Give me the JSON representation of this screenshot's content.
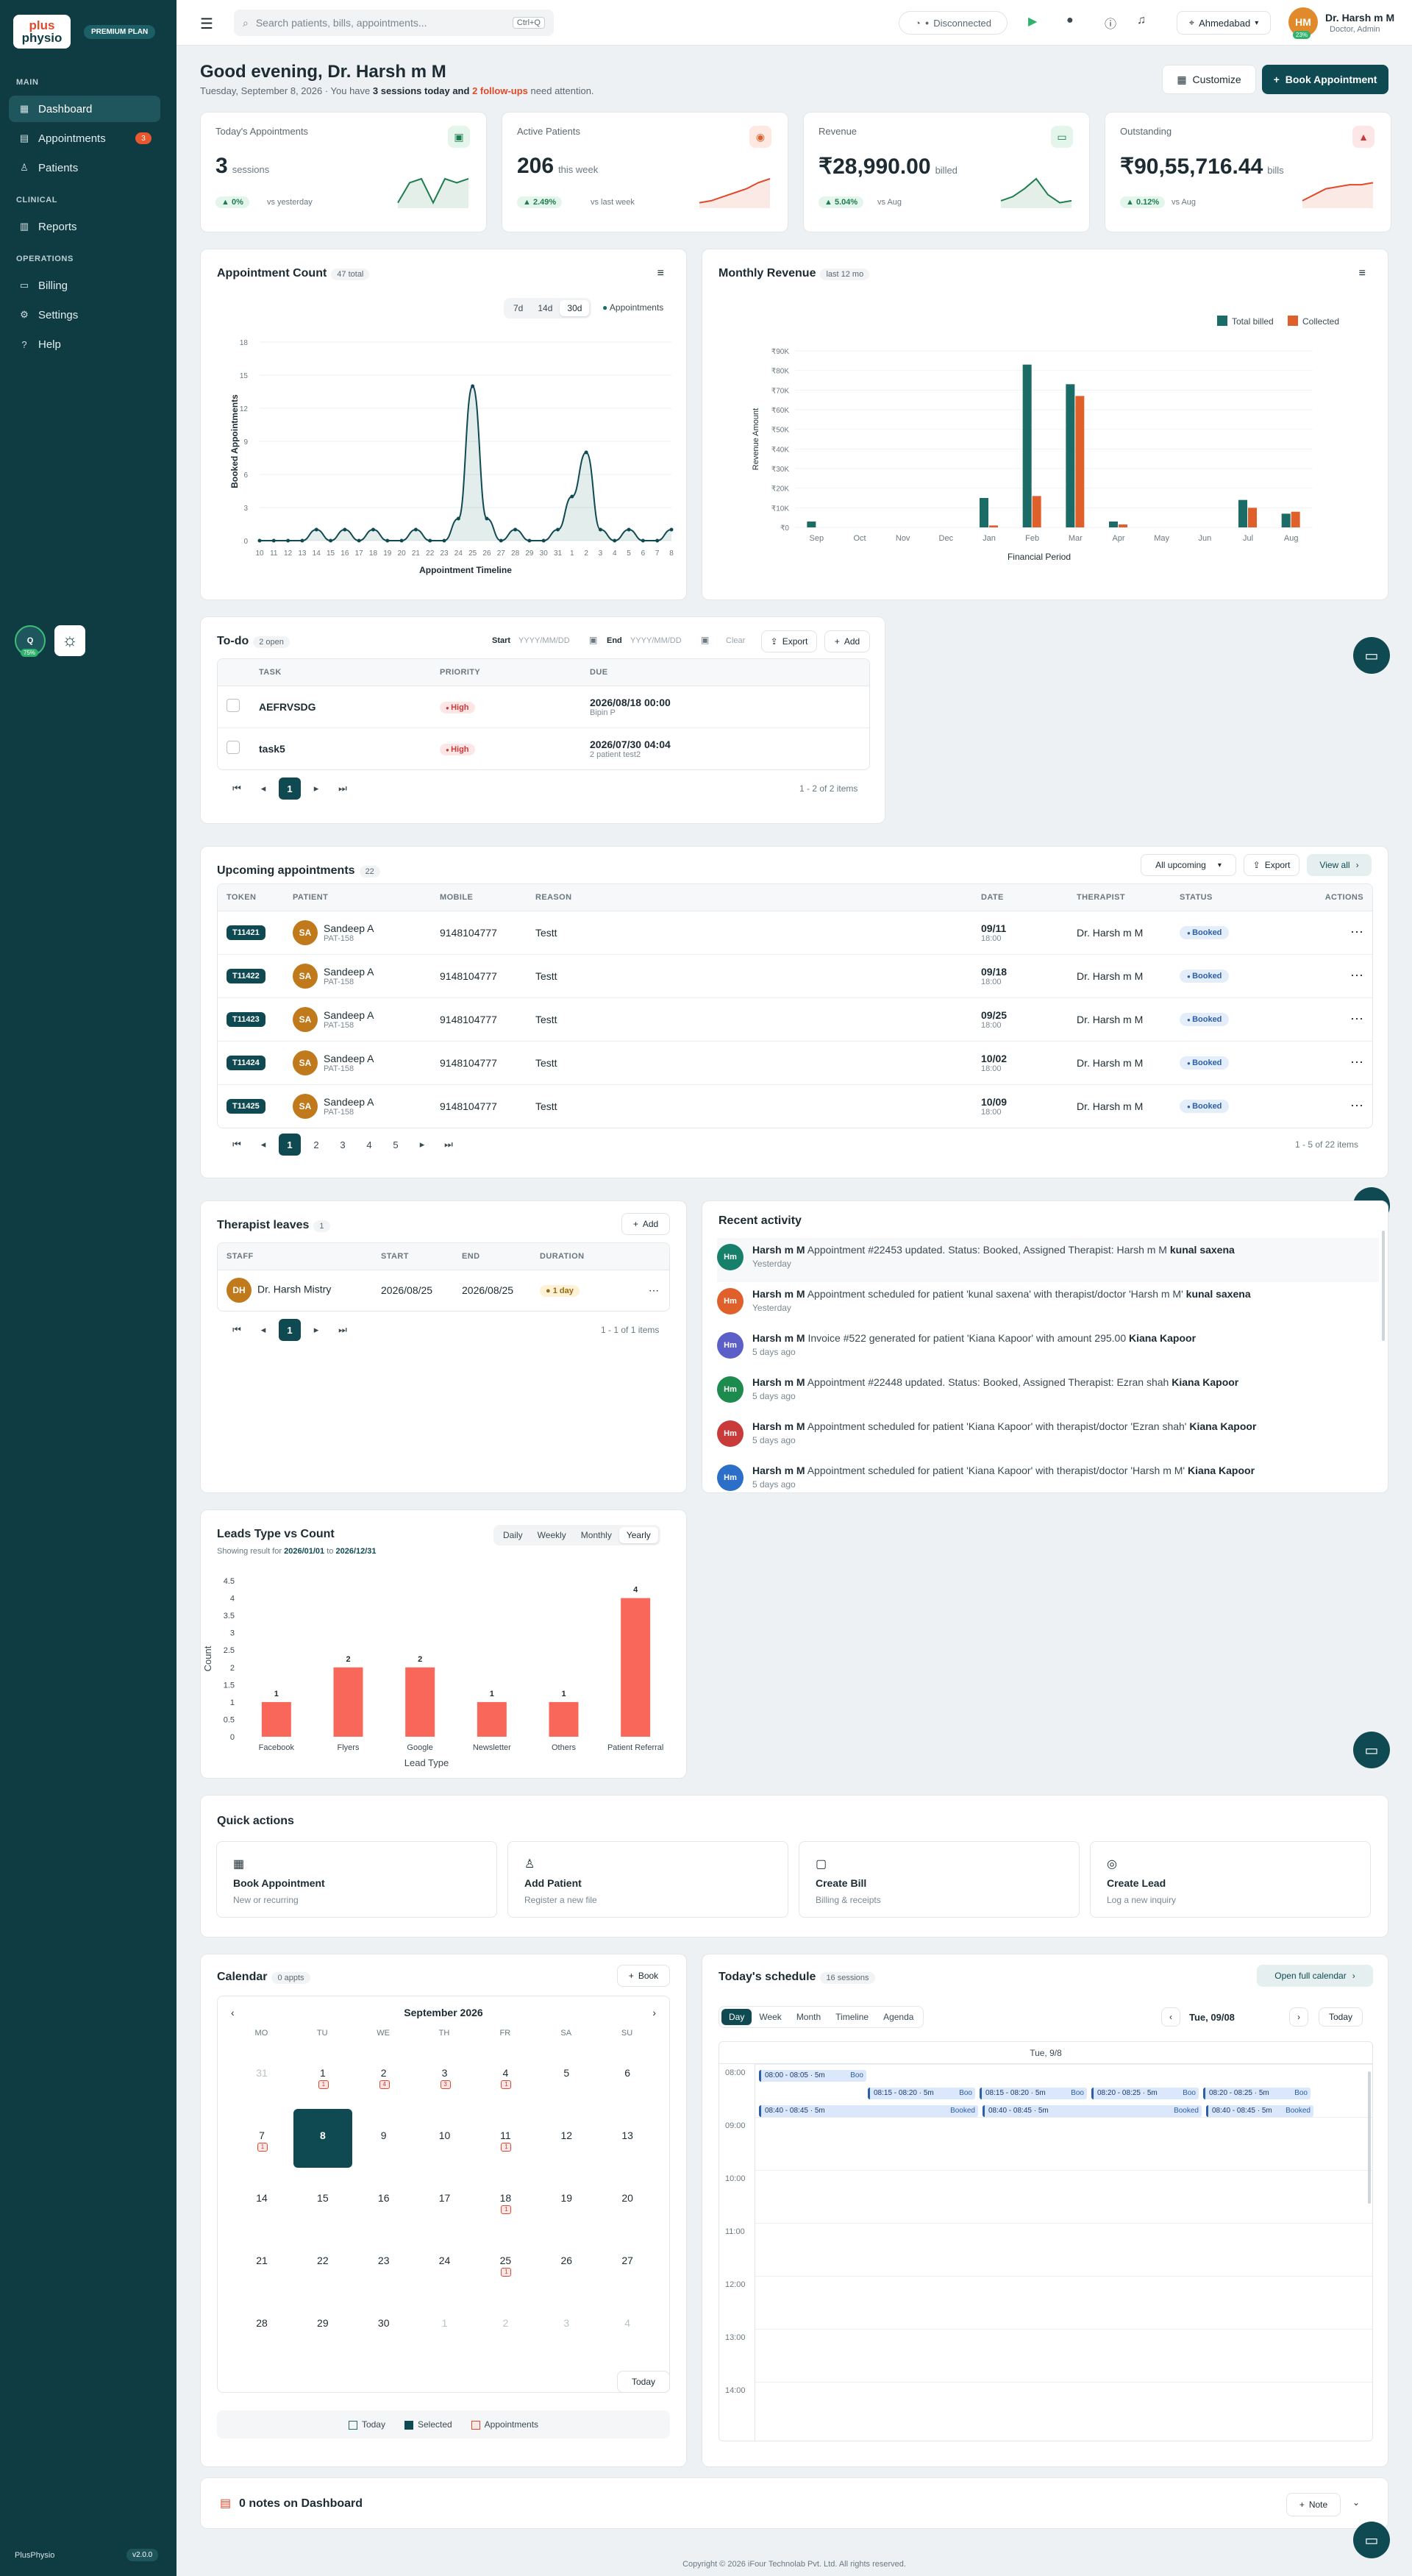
{
  "brand": {
    "logo_top": "plus",
    "logo_bottom": "physio",
    "plan": "PREMIUM PLAN",
    "footer": "PlusPhysio",
    "version": "v2.0.0",
    "widget": "Q",
    "widget_pct": "75%"
  },
  "sidebar": {
    "sections": [
      {
        "label": "MAIN"
      },
      {
        "label": "CLINICAL"
      },
      {
        "label": "OPERATIONS"
      }
    ],
    "items": [
      {
        "label": "Dashboard",
        "icon": "▦"
      },
      {
        "label": "Appointments",
        "icon": "▤",
        "badge": "3"
      },
      {
        "label": "Patients",
        "icon": "♙"
      },
      {
        "label": "Reports",
        "icon": "▥"
      },
      {
        "label": "Billing",
        "icon": "▭"
      },
      {
        "label": "Settings",
        "icon": "⚙"
      },
      {
        "label": "Help",
        "icon": "?"
      }
    ]
  },
  "topbar": {
    "search_placeholder": "Search patients, bills, appointments...",
    "shortcut": "Ctrl+Q",
    "connection": "Disconnected",
    "location": "Ahmedabad",
    "user_initials": "HM",
    "user_pct": "23%",
    "user_name": "Dr. Harsh m M",
    "user_role": "Doctor, Admin"
  },
  "greeting": {
    "title": "Good evening, Dr. Harsh m M",
    "date": "Tuesday, September 8, 2026 · You have",
    "sessions": "3 sessions today",
    "and": "and",
    "followups": "2 follow-ups",
    "tail": "need attention.",
    "customize": "Customize",
    "book": "Book Appointment"
  },
  "kpis": [
    {
      "label": "Today's Appointments",
      "value": "3",
      "unit": "sessions",
      "change": "0%",
      "vs": "vs yesterday",
      "color": "#1d7d4e",
      "spark": [
        2,
        12,
        14,
        2,
        14,
        12,
        14
      ]
    },
    {
      "label": "Active Patients",
      "value": "206",
      "unit": "this week",
      "change": "2.49%",
      "vs": "vs last week",
      "color": "#e2492a",
      "spark": [
        2,
        3,
        5,
        7,
        9,
        12,
        14
      ]
    },
    {
      "label": "Revenue",
      "value": "₹28,990.00",
      "unit": "billed",
      "change": "5.04%",
      "vs": "vs Aug",
      "color": "#1d7d4e",
      "spark": [
        3,
        5,
        9,
        14,
        6,
        2,
        3
      ]
    },
    {
      "label": "Outstanding",
      "value": "₹90,55,716.44",
      "unit": "bills",
      "change": "0.12%",
      "vs": "vs Aug",
      "color": "#e2492a",
      "spark": [
        3,
        6,
        9,
        10,
        11,
        11,
        12
      ]
    }
  ],
  "appt_chart": {
    "title": "Appointment Count",
    "total": "47 total",
    "ranges": [
      "7d",
      "14d",
      "30d"
    ],
    "active_range": "30d",
    "legend": "Appointments",
    "chart_data": {
      "type": "line",
      "xlabel": "Appointment Timeline",
      "ylabel": "Booked Appointments",
      "ylim": [
        0,
        18
      ],
      "yticks": [
        0,
        3,
        6,
        9,
        12,
        15,
        18
      ],
      "categories": [
        "10",
        "11",
        "12",
        "13",
        "14",
        "15",
        "16",
        "17",
        "18",
        "19",
        "20",
        "21",
        "22",
        "23",
        "24",
        "25",
        "26",
        "27",
        "28",
        "29",
        "30",
        "31",
        "1",
        "2",
        "3",
        "4",
        "5",
        "6",
        "7",
        "8"
      ],
      "values": [
        0,
        0,
        0,
        0,
        1,
        0,
        1,
        0,
        1,
        0,
        0,
        1,
        0,
        0,
        2,
        14,
        2,
        0,
        1,
        0,
        0,
        1,
        4,
        8,
        1,
        0,
        1,
        0,
        0,
        1
      ]
    }
  },
  "rev_chart": {
    "title": "Monthly Revenue",
    "tag": "last 12 mo",
    "chart_data": {
      "type": "bar",
      "xlabel": "Financial Period",
      "ylabel": "Revenue Amount",
      "ylim": [
        0,
        90000
      ],
      "yticks": [
        "₹0",
        "₹10K",
        "₹20K",
        "₹30K",
        "₹40K",
        "₹50K",
        "₹60K",
        "₹70K",
        "₹80K",
        "₹90K"
      ],
      "categories": [
        "Sep",
        "Oct",
        "Nov",
        "Dec",
        "Jan",
        "Feb",
        "Mar",
        "Apr",
        "May",
        "Jun",
        "Jul",
        "Aug"
      ],
      "series": [
        {
          "name": "Total billed",
          "color": "#1b6b66",
          "values": [
            3000,
            0,
            0,
            0,
            15000,
            83000,
            73000,
            3000,
            0,
            0,
            14000,
            7000
          ]
        },
        {
          "name": "Collected",
          "color": "#e0602c",
          "values": [
            0,
            0,
            0,
            0,
            1000,
            16000,
            67000,
            1500,
            0,
            0,
            10000,
            8000
          ]
        }
      ]
    }
  },
  "todo": {
    "title": "To-do",
    "count": "2 open",
    "start": "Start",
    "end": "End",
    "date_ph": "YYYY/MM/DD",
    "clear": "Clear",
    "export": "Export",
    "add": "Add",
    "headers": [
      "TASK",
      "PRIORITY",
      "DUE"
    ],
    "rows": [
      {
        "task": "AEFRVSDG",
        "priority": "High",
        "due": "2026/08/18 00:00",
        "who": "Bipin P"
      },
      {
        "task": "task5",
        "priority": "High",
        "due": "2026/07/30 04:04",
        "who": "2 patient test2"
      }
    ],
    "page": "1",
    "info": "1 - 2 of 2 items"
  },
  "upcoming": {
    "title": "Upcoming appointments",
    "count": "22",
    "filter": "All upcoming",
    "export": "Export",
    "view_all": "View all",
    "headers": [
      "TOKEN",
      "PATIENT",
      "MOBILE",
      "REASON",
      "DATE",
      "THERAPIST",
      "STATUS",
      "ACTIONS"
    ],
    "rows": [
      {
        "token": "T11421",
        "initials": "SA",
        "name": "Sandeep A",
        "pid": "PAT-158",
        "mobile": "9148104777",
        "reason": "Testt",
        "date": "09/11",
        "time": "18:00",
        "therapist": "Dr. Harsh m M",
        "status": "Booked"
      },
      {
        "token": "T11422",
        "initials": "SA",
        "name": "Sandeep A",
        "pid": "PAT-158",
        "mobile": "9148104777",
        "reason": "Testt",
        "date": "09/18",
        "time": "18:00",
        "therapist": "Dr. Harsh m M",
        "status": "Booked"
      },
      {
        "token": "T11423",
        "initials": "SA",
        "name": "Sandeep A",
        "pid": "PAT-158",
        "mobile": "9148104777",
        "reason": "Testt",
        "date": "09/25",
        "time": "18:00",
        "therapist": "Dr. Harsh m M",
        "status": "Booked"
      },
      {
        "token": "T11424",
        "initials": "SA",
        "name": "Sandeep A",
        "pid": "PAT-158",
        "mobile": "9148104777",
        "reason": "Testt",
        "date": "10/02",
        "time": "18:00",
        "therapist": "Dr. Harsh m M",
        "status": "Booked"
      },
      {
        "token": "T11425",
        "initials": "SA",
        "name": "Sandeep A",
        "pid": "PAT-158",
        "mobile": "9148104777",
        "reason": "Testt",
        "date": "10/09",
        "time": "18:00",
        "therapist": "Dr. Harsh m M",
        "status": "Booked"
      }
    ],
    "pages": [
      "1",
      "2",
      "3",
      "4",
      "5"
    ],
    "info": "1 - 5 of 22 items"
  },
  "leaves": {
    "title": "Therapist leaves",
    "count": "1",
    "add": "Add",
    "headers": [
      "STAFF",
      "START",
      "END",
      "DURATION"
    ],
    "rows": [
      {
        "initials": "DH",
        "staff": "Dr. Harsh Mistry",
        "start": "2026/08/25",
        "end": "2026/08/25",
        "duration": "1 day"
      }
    ],
    "page": "1",
    "info": "1 - 1 of 1 items"
  },
  "activity": {
    "title": "Recent activity",
    "items": [
      {
        "initials": "Hm",
        "color": "#16806a",
        "who": "Harsh m M",
        "text": "Appointment #22453 updated. Status: Booked, Assigned Therapist: Harsh m M",
        "target": "kunal saxena",
        "when": "Yesterday"
      },
      {
        "initials": "Hm",
        "color": "#e0602c",
        "who": "Harsh m M",
        "text": "Appointment scheduled for patient 'kunal saxena' with therapist/doctor 'Harsh m M'",
        "target": "kunal saxena",
        "when": "Yesterday"
      },
      {
        "initials": "Hm",
        "color": "#5b5fc7",
        "who": "Harsh m M",
        "text": "Invoice #522 generated for patient 'Kiana Kapoor' with amount 295.00",
        "target": "Kiana Kapoor",
        "when": "5 days ago"
      },
      {
        "initials": "Hm",
        "color": "#1d8a4e",
        "who": "Harsh m M",
        "text": "Appointment #22448 updated. Status: Booked, Assigned Therapist: Ezran shah",
        "target": "Kiana Kapoor",
        "when": "5 days ago"
      },
      {
        "initials": "Hm",
        "color": "#c93b3b",
        "who": "Harsh m M",
        "text": "Appointment scheduled for patient 'Kiana Kapoor' with therapist/doctor 'Ezran shah'",
        "target": "Kiana Kapoor",
        "when": "5 days ago"
      },
      {
        "initials": "Hm",
        "color": "#2c6fc8",
        "who": "Harsh m M",
        "text": "Appointment scheduled for patient 'Kiana Kapoor' with therapist/doctor 'Harsh m M'",
        "target": "Kiana Kapoor",
        "when": "5 days ago"
      }
    ]
  },
  "leads": {
    "title": "Leads Type vs Count",
    "range_pre": "Showing result for",
    "from": "2026/01/01",
    "to_word": "to",
    "to": "2026/12/31",
    "tabs": [
      "Daily",
      "Weekly",
      "Monthly",
      "Yearly"
    ],
    "active": "Yearly",
    "chart_data": {
      "type": "bar",
      "xlabel": "Lead Type",
      "ylabel": "Count",
      "ylim": [
        0,
        4.5
      ],
      "yticks": [
        "0",
        "0.5",
        "1",
        "1.5",
        "2",
        "2.5",
        "3",
        "3.5",
        "4",
        "4.5"
      ],
      "categories": [
        "Facebook",
        "Flyers",
        "Google",
        "Newsletter",
        "Others",
        "Patient Referral"
      ],
      "values": [
        1,
        2,
        2,
        1,
        1,
        4
      ],
      "color": "#f8675a"
    }
  },
  "quick": {
    "title": "Quick actions",
    "items": [
      {
        "icon": "▦",
        "title": "Book Appointment",
        "sub": "New or recurring"
      },
      {
        "icon": "♙",
        "title": "Add Patient",
        "sub": "Register a new file"
      },
      {
        "icon": "▢",
        "title": "Create Bill",
        "sub": "Billing & receipts"
      },
      {
        "icon": "◎",
        "title": "Create Lead",
        "sub": "Log a new inquiry"
      }
    ]
  },
  "calendar": {
    "title": "Calendar",
    "count": "0 appts",
    "book": "Book",
    "month": "September 2026",
    "weekdays": [
      "MO",
      "TU",
      "WE",
      "TH",
      "FR",
      "SA",
      "SU"
    ],
    "days": [
      {
        "n": "31",
        "muted": true
      },
      {
        "n": "1",
        "dot": "1"
      },
      {
        "n": "2",
        "dot": "4"
      },
      {
        "n": "3",
        "dot": "3"
      },
      {
        "n": "4",
        "dot": "1"
      },
      {
        "n": "5"
      },
      {
        "n": "6"
      },
      {
        "n": "7",
        "dot": "1"
      },
      {
        "n": "8",
        "selected": true
      },
      {
        "n": "9"
      },
      {
        "n": "10"
      },
      {
        "n": "11",
        "dot": "1"
      },
      {
        "n": "12"
      },
      {
        "n": "13"
      },
      {
        "n": "14"
      },
      {
        "n": "15"
      },
      {
        "n": "16"
      },
      {
        "n": "17"
      },
      {
        "n": "18",
        "dot": "1"
      },
      {
        "n": "19"
      },
      {
        "n": "20"
      },
      {
        "n": "21"
      },
      {
        "n": "22"
      },
      {
        "n": "23"
      },
      {
        "n": "24"
      },
      {
        "n": "25",
        "dot": "1"
      },
      {
        "n": "26"
      },
      {
        "n": "27"
      },
      {
        "n": "28"
      },
      {
        "n": "29"
      },
      {
        "n": "30"
      },
      {
        "n": "1",
        "muted": true
      },
      {
        "n": "2",
        "muted": true
      },
      {
        "n": "3",
        "muted": true
      },
      {
        "n": "4",
        "muted": true
      }
    ],
    "today": "Today",
    "legend": [
      "Today",
      "Selected",
      "Appointments"
    ]
  },
  "schedule": {
    "title": "Today's schedule",
    "count": "16 sessions",
    "open": "Open full calendar",
    "views": [
      "Day",
      "Week",
      "Month",
      "Timeline",
      "Agenda"
    ],
    "active": "Day",
    "date": "Tue, 09/08",
    "today": "Today",
    "col": "Tue, 9/8",
    "hours": [
      "08:00",
      "09:00",
      "10:00",
      "11:00",
      "12:00",
      "13:00",
      "14:00"
    ],
    "events": [
      {
        "label": "08:00 - 08:05 · 5m",
        "status": "Boo",
        "col": 0,
        "row": 0,
        "w": 1
      },
      {
        "label": "08:15 - 08:20 · 5m",
        "status": "Boo",
        "col": 1,
        "row": 1,
        "w": 1
      },
      {
        "label": "08:15 - 08:20 · 5m",
        "status": "Boo",
        "col": 2,
        "row": 1,
        "w": 1
      },
      {
        "label": "08:20 - 08:25 · 5m",
        "status": "Boo",
        "col": 3,
        "row": 1,
        "w": 1
      },
      {
        "label": "08:20 - 08:25 · 5m",
        "status": "Boo",
        "col": 4,
        "row": 1,
        "w": 1
      },
      {
        "label": "08:40 - 08:45 · 5m",
        "status": "Booked",
        "col": 0,
        "row": 2,
        "w": 2
      },
      {
        "label": "08:40 - 08:45 · 5m",
        "status": "Booked",
        "col": 2,
        "row": 2,
        "w": 2
      },
      {
        "label": "08:40 - 08:45 · 5m",
        "status": "Booked",
        "col": 4,
        "row": 2,
        "w": 1
      }
    ]
  },
  "notes": {
    "title": "0 notes on Dashboard",
    "add": "Note"
  },
  "footer": "Copyright © 2026 iFour Technolab Pvt. Ltd. All rights reserved."
}
